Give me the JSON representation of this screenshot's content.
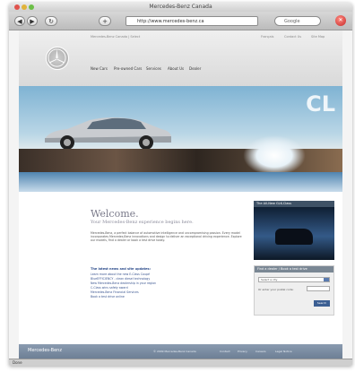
{
  "window": {
    "title": "Mercedes-Benz Canada"
  },
  "toolbar": {
    "back": "◀",
    "forward": "▶",
    "reload": "↻",
    "bookmark": "+",
    "url": "http://www.mercedes-benz.ca",
    "search_placeholder": "Google",
    "stop": "✕"
  },
  "header": {
    "util_left": "Mercedes-Benz Canada | Select",
    "util_right": [
      "Français",
      "Contact Us",
      "Site Map"
    ],
    "nav": [
      "New Cars",
      "Pre-owned Cars",
      "Services",
      "About Us",
      "Dealer"
    ]
  },
  "hero": {
    "model": "CL"
  },
  "main": {
    "welcome": "Welcome.",
    "subtitle": "Your Mercedes-Benz experience begins here.",
    "paragraph": "Mercedes-Benz, a perfect balance of automotive intelligence and uncompromising passion. Every model incorporates Mercedes-Benz innovations and design to deliver an exceptional driving experience. Explore our models, find a dealer or book a test drive today.",
    "latest_title": "The latest news and site updates:",
    "news": [
      "Learn more about the new E-Class Coupé",
      "BlueEFFICIENCY - clean diesel technology",
      "New Mercedes-Benz dealership in your region",
      "C-Class wins safety award",
      "Mercedes-Benz Financial Services",
      "Book a test drive online"
    ]
  },
  "ad": {
    "header": "The All-New GLK-Class"
  },
  "dealer": {
    "header": "Find a dealer / Book a test drive",
    "select_value": "Select a city",
    "postal_label": "Or enter your postal code:",
    "button": "Search"
  },
  "footer": {
    "logo": "Mercedes-Benz",
    "links": [
      "© 2009 Mercedes-Benz Canada",
      "Contact",
      "Privacy",
      "Careers",
      "Legal Notice"
    ]
  },
  "status": {
    "text": "Done"
  }
}
